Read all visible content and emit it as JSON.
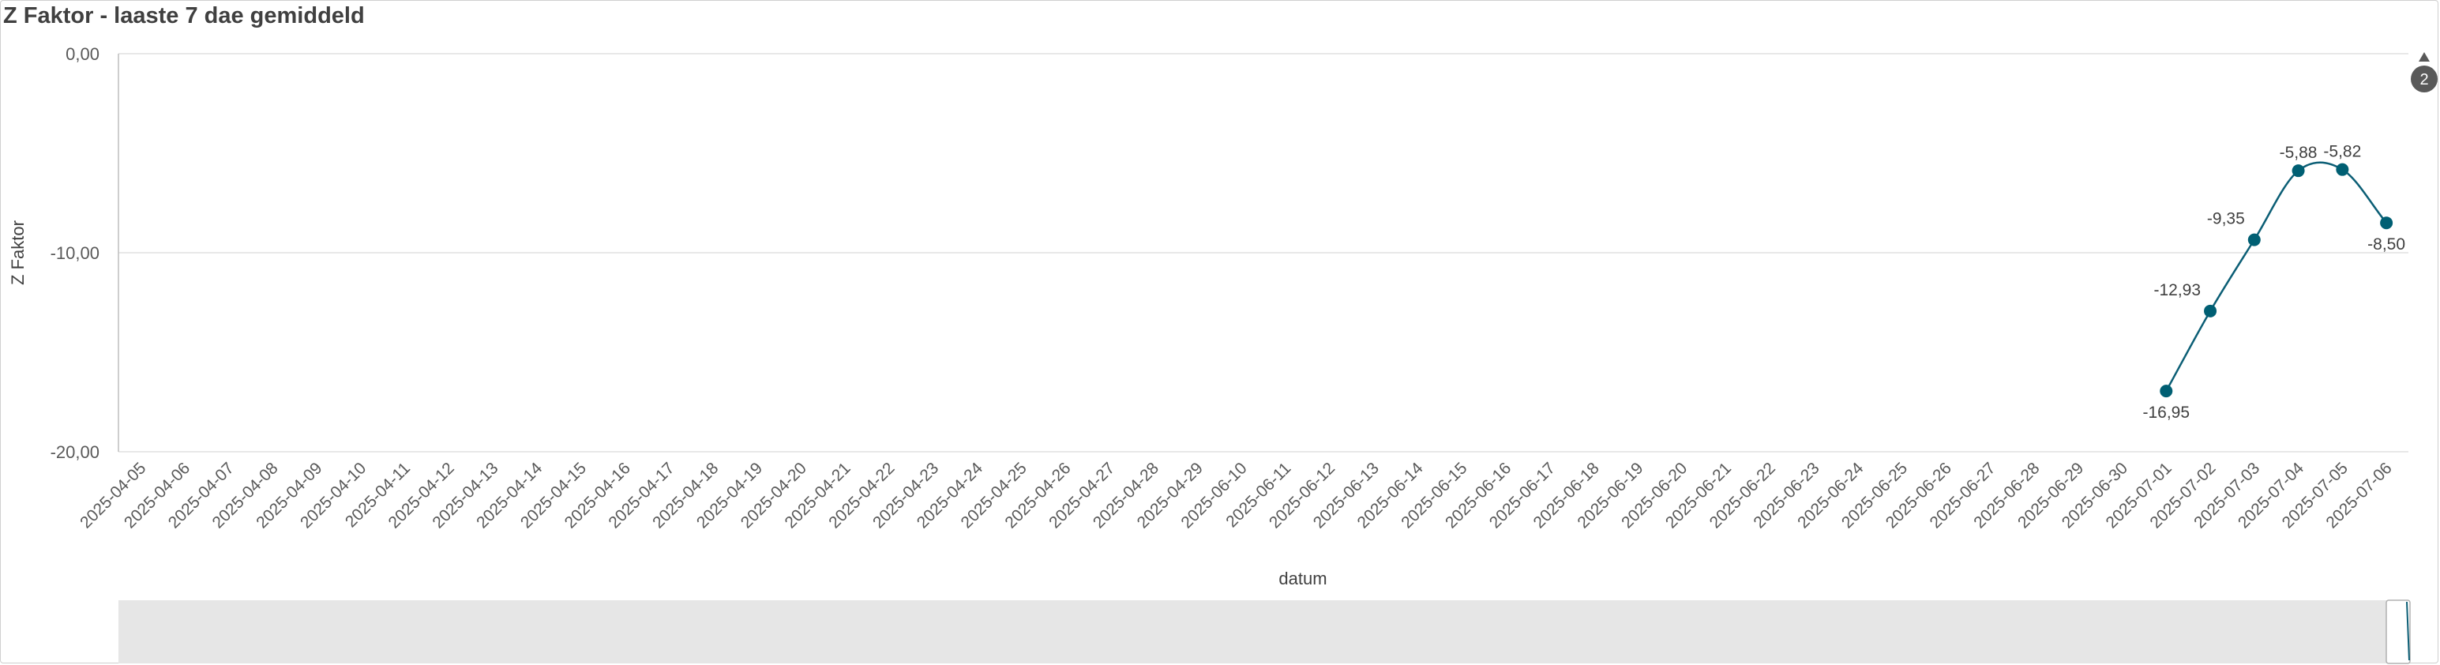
{
  "title": "Z Faktor - laaste 7 dae gemiddeld",
  "colors": {
    "line": "#0b5e75",
    "marker": "#005f73",
    "grid": "#e0e0e0",
    "scroll_track": "#e6e6e6"
  },
  "scroll_badge": "2",
  "chart_data": {
    "type": "line",
    "title": "Z Faktor - laaste 7 dae gemiddeld",
    "xlabel": "datum",
    "ylabel": "Z Faktor",
    "ylim": [
      -20,
      0
    ],
    "yticks": [
      0,
      -10,
      -20
    ],
    "ytick_labels": [
      "0,00",
      "-10,00",
      "-20,00"
    ],
    "grid": true,
    "categories": [
      "2025-04-05",
      "2025-04-06",
      "2025-04-07",
      "2025-04-08",
      "2025-04-09",
      "2025-04-10",
      "2025-04-11",
      "2025-04-12",
      "2025-04-13",
      "2025-04-14",
      "2025-04-15",
      "2025-04-16",
      "2025-04-17",
      "2025-04-18",
      "2025-04-19",
      "2025-04-20",
      "2025-04-21",
      "2025-04-22",
      "2025-04-23",
      "2025-04-24",
      "2025-04-25",
      "2025-04-26",
      "2025-04-27",
      "2025-04-28",
      "2025-04-29",
      "2025-06-10",
      "2025-06-11",
      "2025-06-12",
      "2025-06-13",
      "2025-06-14",
      "2025-06-15",
      "2025-06-16",
      "2025-06-17",
      "2025-06-18",
      "2025-06-19",
      "2025-06-20",
      "2025-06-21",
      "2025-06-22",
      "2025-06-23",
      "2025-06-24",
      "2025-06-25",
      "2025-06-26",
      "2025-06-27",
      "2025-06-28",
      "2025-06-29",
      "2025-06-30",
      "2025-07-01",
      "2025-07-02",
      "2025-07-03",
      "2025-07-04",
      "2025-07-05",
      "2025-07-06"
    ],
    "points": [
      {
        "x": "2025-07-01",
        "y": -16.95,
        "label": "-16,95",
        "label_pos": "below"
      },
      {
        "x": "2025-07-02",
        "y": -12.93,
        "label": "-12,93",
        "label_pos": "above-left"
      },
      {
        "x": "2025-07-03",
        "y": -9.35,
        "label": "-9,35",
        "label_pos": "above-left"
      },
      {
        "x": "2025-07-04",
        "y": -5.88,
        "label": "-5,88",
        "label_pos": "above"
      },
      {
        "x": "2025-07-05",
        "y": -5.82,
        "label": "-5,82",
        "label_pos": "above"
      },
      {
        "x": "2025-07-06",
        "y": -8.5,
        "label": "-8,50",
        "label_pos": "below"
      }
    ]
  }
}
